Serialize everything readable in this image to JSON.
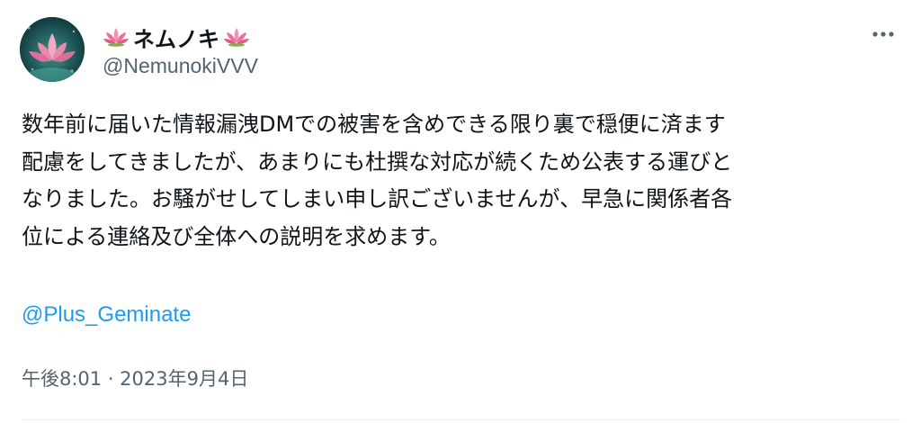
{
  "author": {
    "display_name": "ネムノキ",
    "display_name_emoji": "lotus-emoji",
    "handle": "@NemunokiVVV",
    "avatar_icon": "lotus-icon"
  },
  "header": {
    "more_icon": "more-horizontal-icon"
  },
  "tweet": {
    "text_lines": [
      "数年前に届いた情報漏洩DMでの被害を含めできる限り裏で穏便に済ます",
      "配慮をしてきましたが、あまりにも杜撰な対応が続くため公表する運びと",
      "なりました。お騒がせしてしまい申し訳ございませんが、早急に関係者各",
      "位による連絡及び全体への説明を求めます。"
    ],
    "mention": "@Plus_Geminate",
    "timestamp": "午後8:01 · 2023年9月4日"
  },
  "colors": {
    "text": "#0f1419",
    "secondary": "#536471",
    "link": "#1d9bf0",
    "divider": "#eff3f4"
  }
}
